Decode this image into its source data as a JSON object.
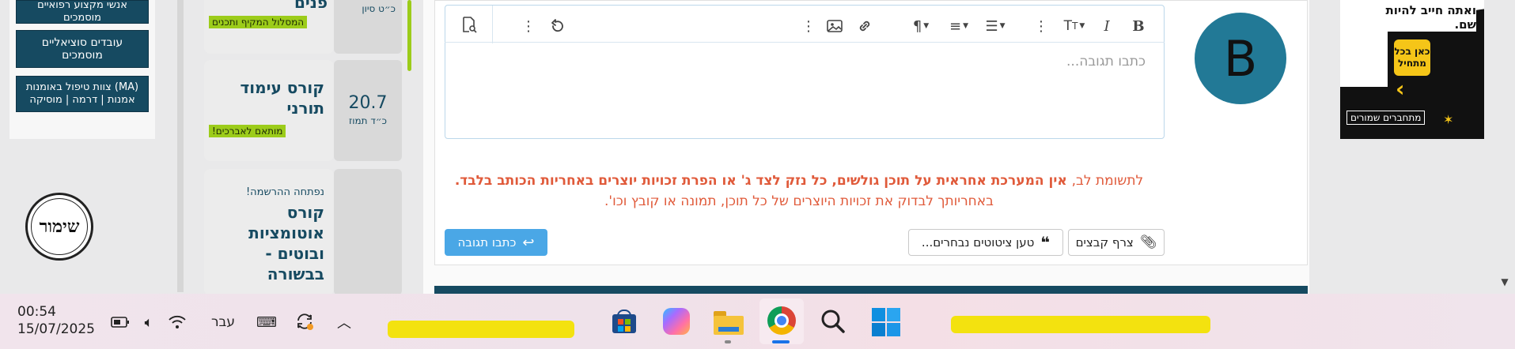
{
  "sidebar": {
    "items": [
      {
        "label": "אנשי מקצוע רפואיים מוסמכים"
      },
      {
        "label": "עובדים סוציאליים מוסמכים"
      },
      {
        "label": "צוות טיפול באומנות (MA) אמנות | דרמה | מוסיקה"
      }
    ],
    "logo_text": "שימור"
  },
  "courses": [
    {
      "title": "פנים",
      "tag": "המסלול המקיף ותכנים",
      "date": "כ״ט סיון",
      "day": ""
    },
    {
      "title": "קורס עימוד תורני",
      "tag": "מותאם לאברכים!",
      "day": "20.7",
      "date": "כ״ד תמוז"
    },
    {
      "pre": "נפתחה ההרשמה!",
      "title": "קורס אוטומציות ובוטים - בבשורה",
      "tag": "",
      "day": "",
      "date": ""
    }
  ],
  "editor": {
    "placeholder": "כתבו תגובה...",
    "toolbar": [
      "bold-icon",
      "italic-icon",
      "text-size-icon",
      "more-icon",
      "list-icon",
      "align-icon",
      "paragraph-icon",
      "more-icon",
      "link-icon",
      "image-icon",
      "more-icon",
      "undo-icon",
      "preview-icon"
    ]
  },
  "avatar": {
    "letter": "B"
  },
  "disclaimer": {
    "line1_prefix": "לתשומת לב,",
    "line1_bold": " אין המערכת אחראית על תוכן גולשים, כל נזק לצד ג' או הפרת זכויות יוצרים באחריות הכותב בלבד.",
    "line2": "באחריותך לבדוק את זכויות היוצרים של כל תוכן, תמונה או קובץ וכו'."
  },
  "buttons": {
    "attach": "צרף קבצים",
    "quotes": "טען ציטוטים נבחרים...",
    "reply": "כתבו תגובה"
  },
  "ad": {
    "headline": "ואתה חייב להיות שם.",
    "cta": "כאן בכל מתחיל",
    "brand": "מתחברים שמורים"
  },
  "taskbar": {
    "time": "00:54",
    "date": "15/07/2025",
    "lang": "עבר",
    "apps": [
      "store-icon",
      "copilot-icon",
      "file-explorer-icon",
      "chrome-icon",
      "search-icon",
      "start-icon"
    ]
  },
  "colors": {
    "accent": "#164a61",
    "green": "#9ccc1a",
    "reply": "#4aa7e6",
    "warning": "#e05a3a",
    "avatar": "#227996"
  }
}
